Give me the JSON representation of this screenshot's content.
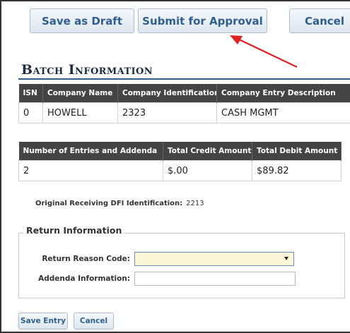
{
  "toolbar": {
    "save_draft_label": "Save as Draft",
    "submit_label": "Submit for Approval",
    "cancel_label": "Cancel"
  },
  "batch": {
    "title": "Batch Information",
    "table1": {
      "headers": [
        "ISN",
        "Company Name",
        "Company Identification",
        "Company Entry Description"
      ],
      "row": [
        "0",
        "HOWELL",
        "2323",
        "CASH MGMT"
      ]
    },
    "table2": {
      "headers": [
        "Number of Entries and Addenda",
        "Total Credit Amount",
        "Total Debit Amount"
      ],
      "row": [
        "2",
        "$.00",
        "$89.82"
      ]
    },
    "dfi_label": "Original Receiving DFI Identification:",
    "dfi_value": "2213"
  },
  "return_info": {
    "legend": "Return Information",
    "reason_label": "Return Reason Code:",
    "reason_value": "",
    "addenda_label": "Addenda Information:",
    "addenda_value": ""
  },
  "footer": {
    "save_entry_label": "Save Entry",
    "cancel_label": "Cancel"
  },
  "colors": {
    "header_bg": "#444444",
    "button_text": "#2e5f8e",
    "select_bg": "#fbf6d6",
    "annotation_arrow": "#e02020"
  }
}
